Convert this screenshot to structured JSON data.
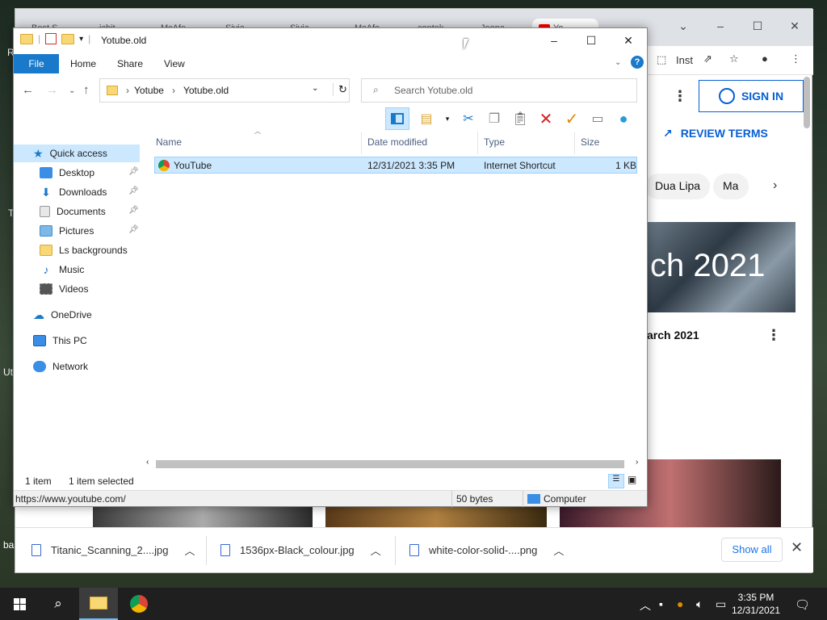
{
  "desktop": {
    "letters": [
      "R",
      "T",
      "Ut",
      "ba"
    ]
  },
  "chrome": {
    "tabs": [
      "Best S",
      "ichit",
      "McAfe",
      "Sivia",
      "Sivia",
      "McAfe",
      "contek",
      "Jeopa",
      "Yo"
    ],
    "toolbar_text": "Inst",
    "sign_in": "SIGN IN",
    "review_terms": "REVIEW TERMS",
    "chips": [
      "Dua Lipa",
      "Ma"
    ],
    "thumb_text": "ch 2021",
    "video_title": "arch 2021"
  },
  "downloads": {
    "items": [
      {
        "name": "Titanic_Scanning_2....jpg"
      },
      {
        "name": "1536px-Black_colour.jpg"
      },
      {
        "name": "white-color-solid-....png"
      }
    ],
    "show_all": "Show all"
  },
  "explorer": {
    "title": "Yotube.old",
    "ribbon": {
      "file": "File",
      "home": "Home",
      "share": "Share",
      "view": "View"
    },
    "breadcrumb": [
      "Yotube",
      "Yotube.old"
    ],
    "search_placeholder": "Search Yotube.old",
    "nav": {
      "quick_access": "Quick access",
      "items": [
        {
          "label": "Desktop",
          "pinned": true,
          "icon": "desktop-icon"
        },
        {
          "label": "Downloads",
          "pinned": true,
          "icon": "downloads-icon"
        },
        {
          "label": "Documents",
          "pinned": true,
          "icon": "documents-icon"
        },
        {
          "label": "Pictures",
          "pinned": true,
          "icon": "pictures-icon"
        },
        {
          "label": "Ls backgrounds",
          "pinned": false,
          "icon": "folder-icon"
        },
        {
          "label": "Music",
          "pinned": false,
          "icon": "music-icon"
        },
        {
          "label": "Videos",
          "pinned": false,
          "icon": "videos-icon"
        }
      ],
      "onedrive": "OneDrive",
      "this_pc": "This PC",
      "network": "Network"
    },
    "columns": {
      "name": "Name",
      "date": "Date modified",
      "type": "Type",
      "size": "Size"
    },
    "files": [
      {
        "name": "YouTube",
        "date": "12/31/2021 3:35 PM",
        "type": "Internet Shortcut",
        "size": "1 KB"
      }
    ],
    "status": {
      "count": "1 item",
      "selected": "1 item selected"
    },
    "info": {
      "url": "https://www.youtube.com/",
      "bytes": "50 bytes",
      "location": "Computer"
    }
  },
  "taskbar": {
    "time": "3:35 PM",
    "date": "12/31/2021"
  },
  "colors": {
    "accent": "#1979ca",
    "selection": "#cce8ff",
    "youtube_blue": "#065fd4"
  }
}
